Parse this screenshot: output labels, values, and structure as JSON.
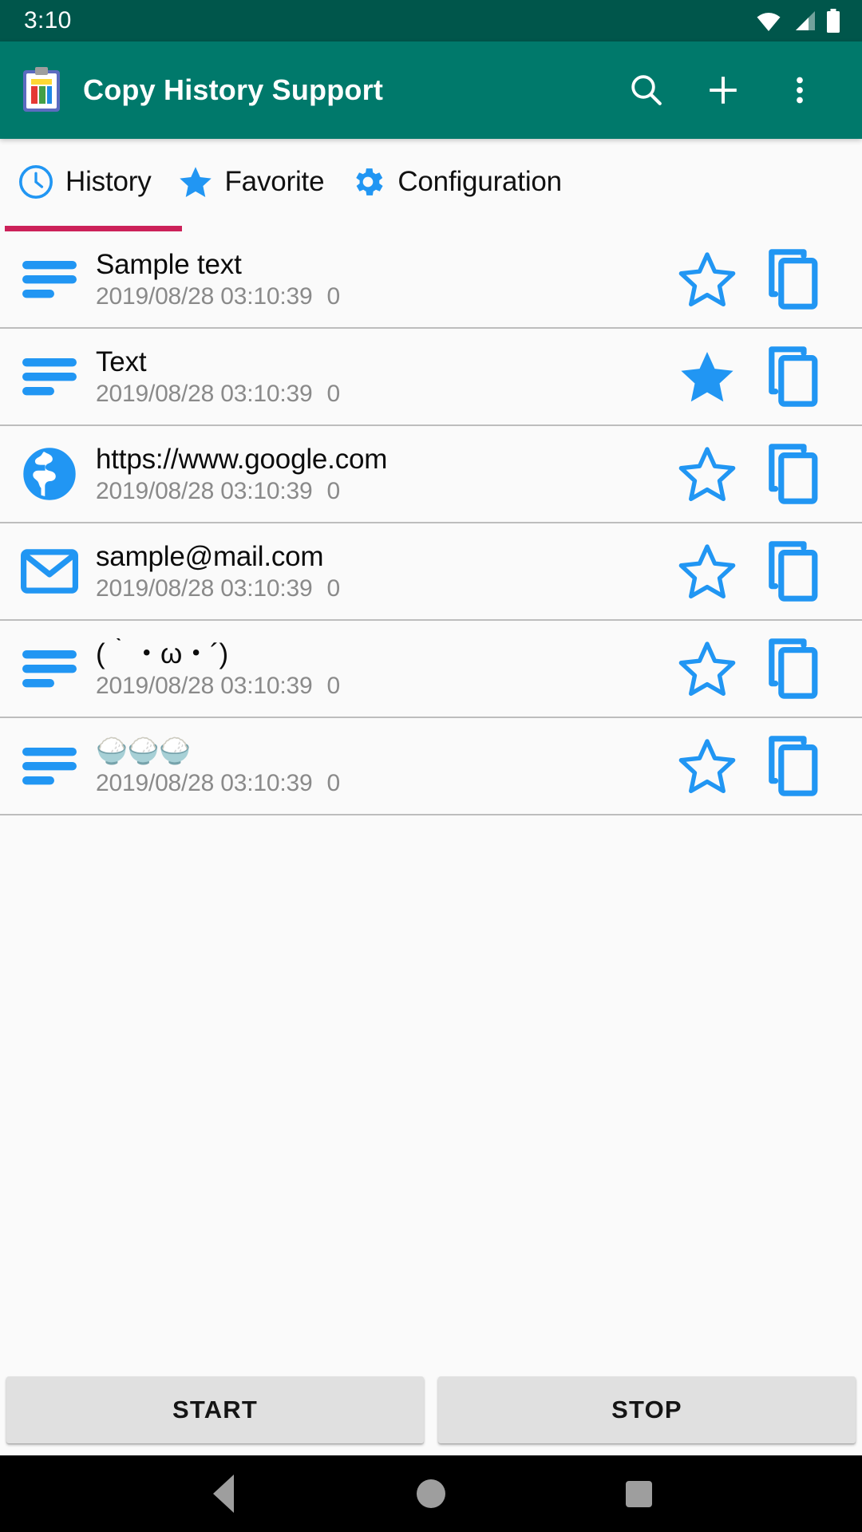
{
  "status_bar": {
    "time": "3:10",
    "icons": [
      "wifi-icon",
      "cellular-signal-icon",
      "battery-icon"
    ],
    "background": "#00564B"
  },
  "app_bar": {
    "logo_icon": "clipboard-icon",
    "title": "Copy History Support",
    "background": "#00796B",
    "actions": [
      {
        "name": "search-icon",
        "label": "Search"
      },
      {
        "name": "add-icon",
        "label": "Add"
      },
      {
        "name": "overflow-menu-icon",
        "label": "More options"
      }
    ]
  },
  "tabs": {
    "indicator_color": "#CC2159",
    "accent_color": "#2196F3",
    "selected_index": 0,
    "items": [
      {
        "label": "History",
        "icon": "clock-icon"
      },
      {
        "label": "Favorite",
        "icon": "star-filled-icon"
      },
      {
        "label": "Configuration",
        "icon": "gear-icon"
      }
    ]
  },
  "list": {
    "star_on_icon": "star-filled-icon",
    "star_off_icon": "star-outline-icon",
    "copy_icon": "copy-icon",
    "rows": [
      {
        "icon": "text-lines-icon",
        "title": "Sample text",
        "timestamp": "2019/08/28 03:10:39",
        "count": "0",
        "favorite": false
      },
      {
        "icon": "text-lines-icon",
        "title": "Text",
        "timestamp": "2019/08/28 03:10:39",
        "count": "0",
        "favorite": true
      },
      {
        "icon": "globe-icon",
        "title": "https://www.google.com",
        "timestamp": "2019/08/28 03:10:39",
        "count": "0",
        "favorite": false
      },
      {
        "icon": "mail-icon",
        "title": "sample@mail.com",
        "timestamp": "2019/08/28 03:10:39",
        "count": "0",
        "favorite": false
      },
      {
        "icon": "text-lines-icon",
        "title": "(｀・ω・´)",
        "timestamp": "2019/08/28 03:10:39",
        "count": "0",
        "favorite": false
      },
      {
        "icon": "text-lines-icon",
        "title": "🍚🍚🍚",
        "timestamp": "2019/08/28 03:10:39",
        "count": "0",
        "favorite": false
      }
    ]
  },
  "bottom_buttons": {
    "start_label": "START",
    "stop_label": "STOP"
  },
  "nav_bar": {
    "back": "back-triangle-icon",
    "home": "home-circle-icon",
    "recents": "recents-square-icon"
  }
}
